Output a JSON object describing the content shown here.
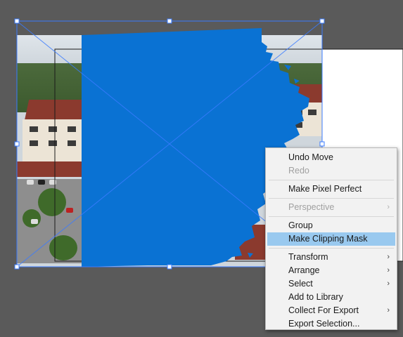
{
  "colors": {
    "workspace_bg": "#5a5a5a",
    "shape_fill": "#0a72d3",
    "selection": "#3a7bff",
    "menu_bg": "#f2f2f2",
    "menu_highlight": "#99c9ef"
  },
  "canvas": {
    "selected_object": "blue-paint-shape",
    "photo": "aerial-photo-buildings"
  },
  "menu": {
    "undo": "Undo Move",
    "redo": "Redo",
    "pixel_perfect": "Make Pixel Perfect",
    "perspective": "Perspective",
    "group": "Group",
    "clipping_mask": "Make Clipping Mask",
    "transform": "Transform",
    "arrange": "Arrange",
    "select": "Select",
    "add_library": "Add to Library",
    "collect_export": "Collect For Export",
    "export_selection": "Export Selection...",
    "submenu_arrow": "›"
  }
}
